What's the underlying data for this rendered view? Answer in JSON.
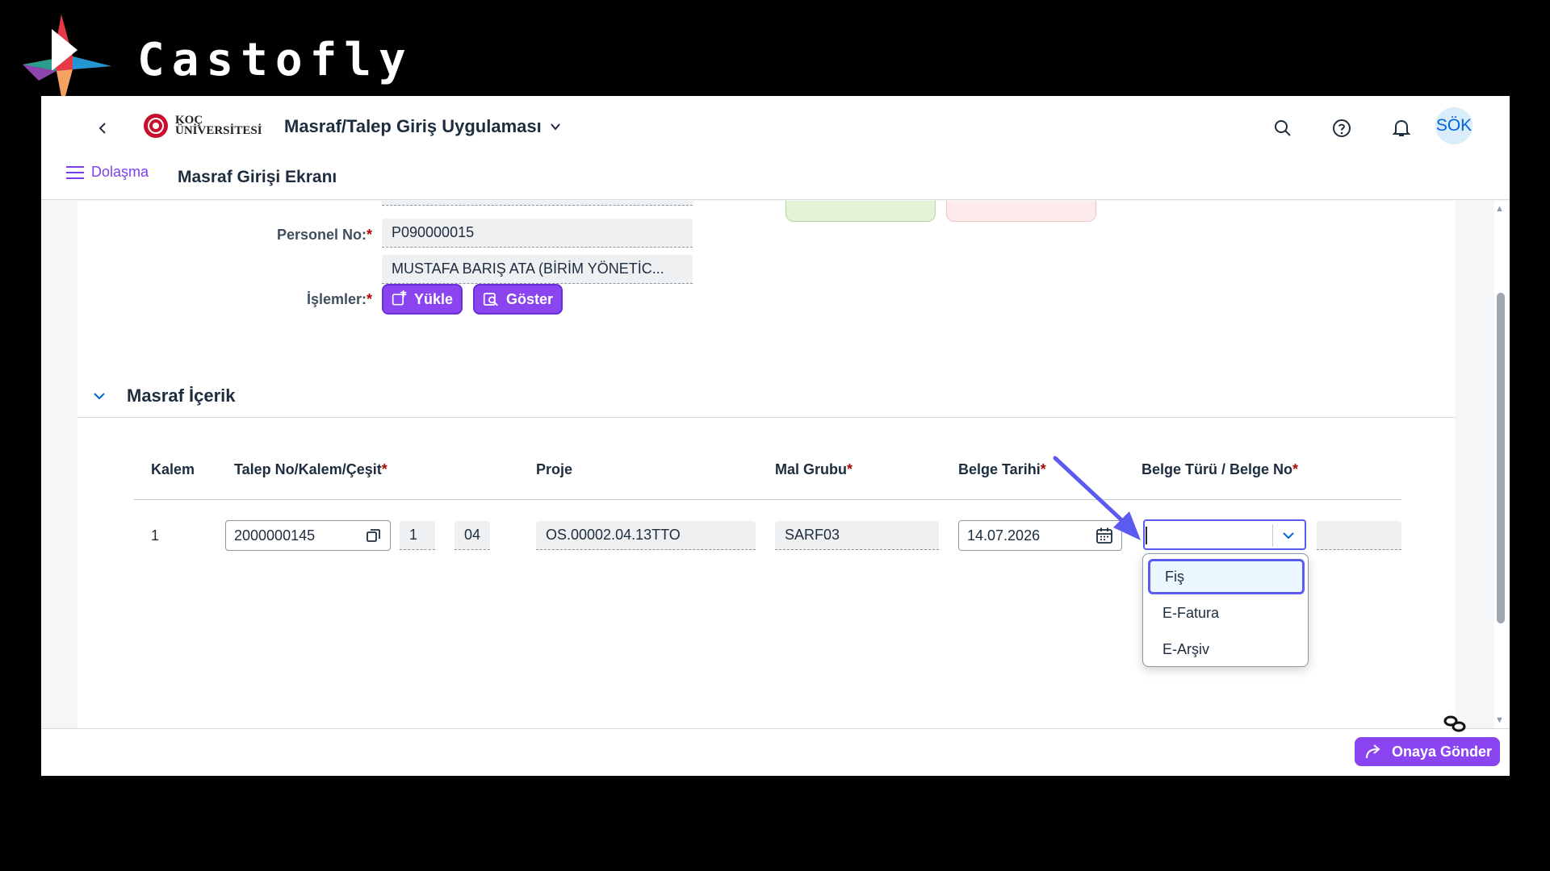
{
  "watermark": {
    "text": "Castofly"
  },
  "shell": {
    "logo_text_1": "KOÇ",
    "logo_text_2": "ÜNİVERSİTESİ",
    "app_title": "Masraf/Talep Giriş Uygulaması",
    "avatar": "SÖK",
    "icons": [
      "back-icon",
      "search-icon",
      "help-icon",
      "bell-icon"
    ]
  },
  "nav": {
    "menu_label": "Dolaşma",
    "page_title": "Masraf Girişi Ekranı"
  },
  "header_form": {
    "personel_label": "Personel No:",
    "personel_no": "P090000015",
    "personel_name": "MUSTAFA BARIŞ  ATA (BİRİM YÖNETİC...",
    "islemler_label": "İşlemler:",
    "yukle_label": "Yükle",
    "goster_label": "Göster",
    "required_mark": "*"
  },
  "section": {
    "title": "Masraf İçerik"
  },
  "table": {
    "headers": [
      "Kalem",
      "Talep No/Kalem/Çeşit",
      "Proje",
      "Mal Grubu",
      "Belge Tarihi",
      "Belge Türü / Belge No"
    ],
    "row": {
      "kalem": "1",
      "talep_no": "2000000145",
      "kalem_no": "1",
      "cesit": "04",
      "proje": "OS.00002.04.13TTO",
      "mal_grubu": "SARF03",
      "belge_tarihi": "14.07.2026",
      "belge_turu": ""
    }
  },
  "dropdown": {
    "options": [
      "Fiş",
      "E-Fatura",
      "E-Arşiv"
    ],
    "selected": "Fiş"
  },
  "footer": {
    "send_label": "Onaya Gönder"
  },
  "colors": {
    "accent": "#8a45f0",
    "focus": "#5b5bf0",
    "link": "#0064d9",
    "required": "#aa0808"
  }
}
